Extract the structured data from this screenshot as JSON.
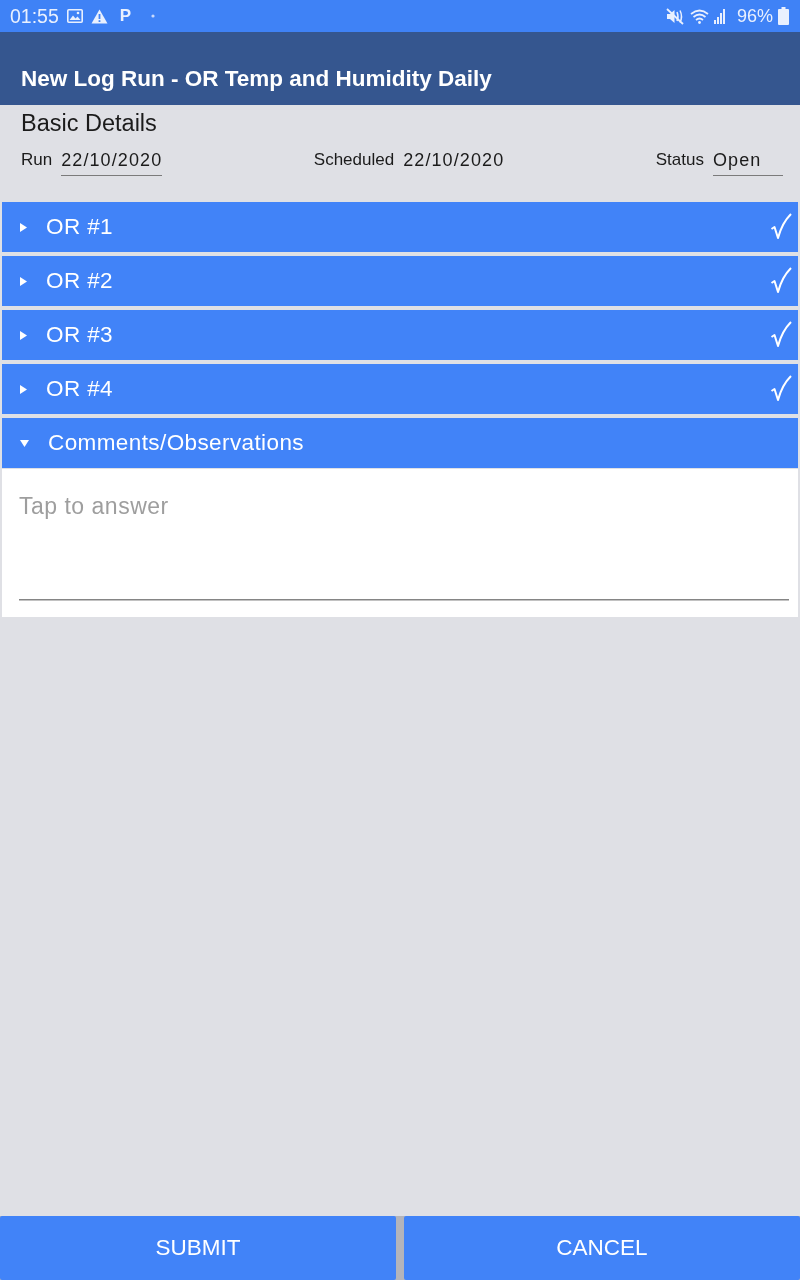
{
  "status_bar": {
    "time": "01:55",
    "notification_letter": "P",
    "battery": "96%"
  },
  "header": {
    "title": "New Log Run - OR Temp and Humidity Daily"
  },
  "basic_details": {
    "heading": "Basic Details",
    "fields": [
      {
        "label": "Run",
        "value": "22/10/2020",
        "kind": "input"
      },
      {
        "label": "Scheduled",
        "value": "22/10/2020",
        "kind": "text"
      },
      {
        "label": "Status",
        "value": "Open",
        "kind": "input"
      }
    ]
  },
  "sections": [
    {
      "title": "OR #1",
      "expanded": false,
      "complete": true
    },
    {
      "title": "OR #2",
      "expanded": false,
      "complete": true
    },
    {
      "title": "OR #3",
      "expanded": false,
      "complete": true
    },
    {
      "title": "OR #4",
      "expanded": false,
      "complete": true
    },
    {
      "title": "Comments/Observations",
      "expanded": true,
      "complete": false,
      "answer": {
        "placeholder": "Tap to answer"
      }
    }
  ],
  "buttons": [
    {
      "label": "SUBMIT"
    },
    {
      "label": "CANCEL"
    }
  ]
}
